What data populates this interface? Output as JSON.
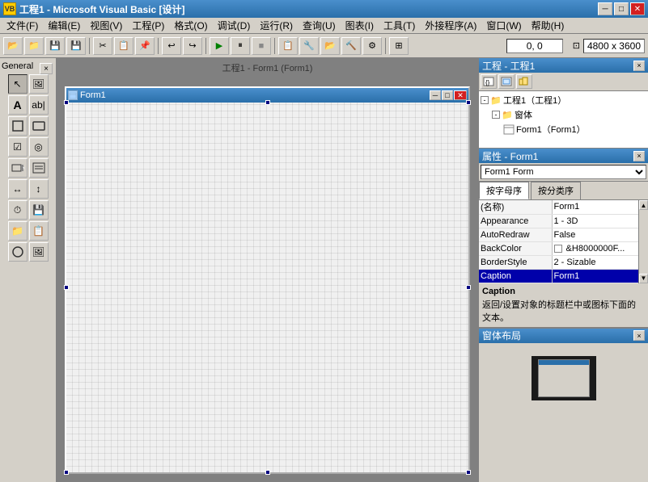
{
  "title_bar": {
    "title": "工程1 - Microsoft Visual Basic [设计]",
    "icon": "VB",
    "minimize": "─",
    "maximize": "□",
    "close": "✕"
  },
  "menu_bar": {
    "items": [
      "文件(F)",
      "编辑(E)",
      "视图(V)",
      "工程(P)",
      "格式(O)",
      "调试(D)",
      "运行(R)",
      "查询(U)",
      "图表(I)",
      "工具(T)",
      "外接程序(A)",
      "窗口(W)",
      "帮助(H)"
    ]
  },
  "toolbar": {
    "coords_label": "0, 0",
    "size_label": "4800 x 3600"
  },
  "toolbox": {
    "label": "General",
    "close": "×",
    "tools": [
      "↖",
      "🖼",
      "A",
      "ab|",
      "▢",
      "▢",
      "╱",
      "☑",
      "◎",
      "≡",
      "▤",
      "↕",
      "⏱",
      "📁",
      "🔵",
      "📋",
      "📊",
      "🖼"
    ]
  },
  "design_area": {
    "form_title": "Form1",
    "outer_label": "工程1 - Form1 (Form1)",
    "form_icon": "📄"
  },
  "project_panel": {
    "title": "工程 - 工程1",
    "close": "×",
    "tree": [
      {
        "indent": 0,
        "expand": "-",
        "icon": "📁",
        "label": "工程1（工程1）",
        "selected": false
      },
      {
        "indent": 1,
        "expand": null,
        "icon": "📁",
        "label": "窗体",
        "selected": false
      },
      {
        "indent": 2,
        "expand": null,
        "icon": "📄",
        "label": "Form1（Form1）",
        "selected": false
      }
    ]
  },
  "properties_panel": {
    "title": "属性 - Form1",
    "close": "×",
    "object_select": "Form1  Form",
    "tab_alpha": "按字母序",
    "tab_category": "按分类序",
    "rows": [
      {
        "name": "(名称)",
        "value": "Form1",
        "selected": false
      },
      {
        "name": "Appearance",
        "value": "1 - 3D",
        "selected": false
      },
      {
        "name": "AutoRedraw",
        "value": "False",
        "selected": false
      },
      {
        "name": "BackColor",
        "value": "□ &H8000000F...",
        "selected": false
      },
      {
        "name": "BorderStyle",
        "value": "2 - Sizable",
        "selected": false
      },
      {
        "name": "Caption",
        "value": "Form1",
        "selected": true
      }
    ],
    "description": {
      "title": "Caption",
      "text": "返回/设置对象的标题栏中或图标下面的文本。"
    }
  },
  "layout_panel": {
    "title": "窗体布局",
    "close": "×"
  }
}
